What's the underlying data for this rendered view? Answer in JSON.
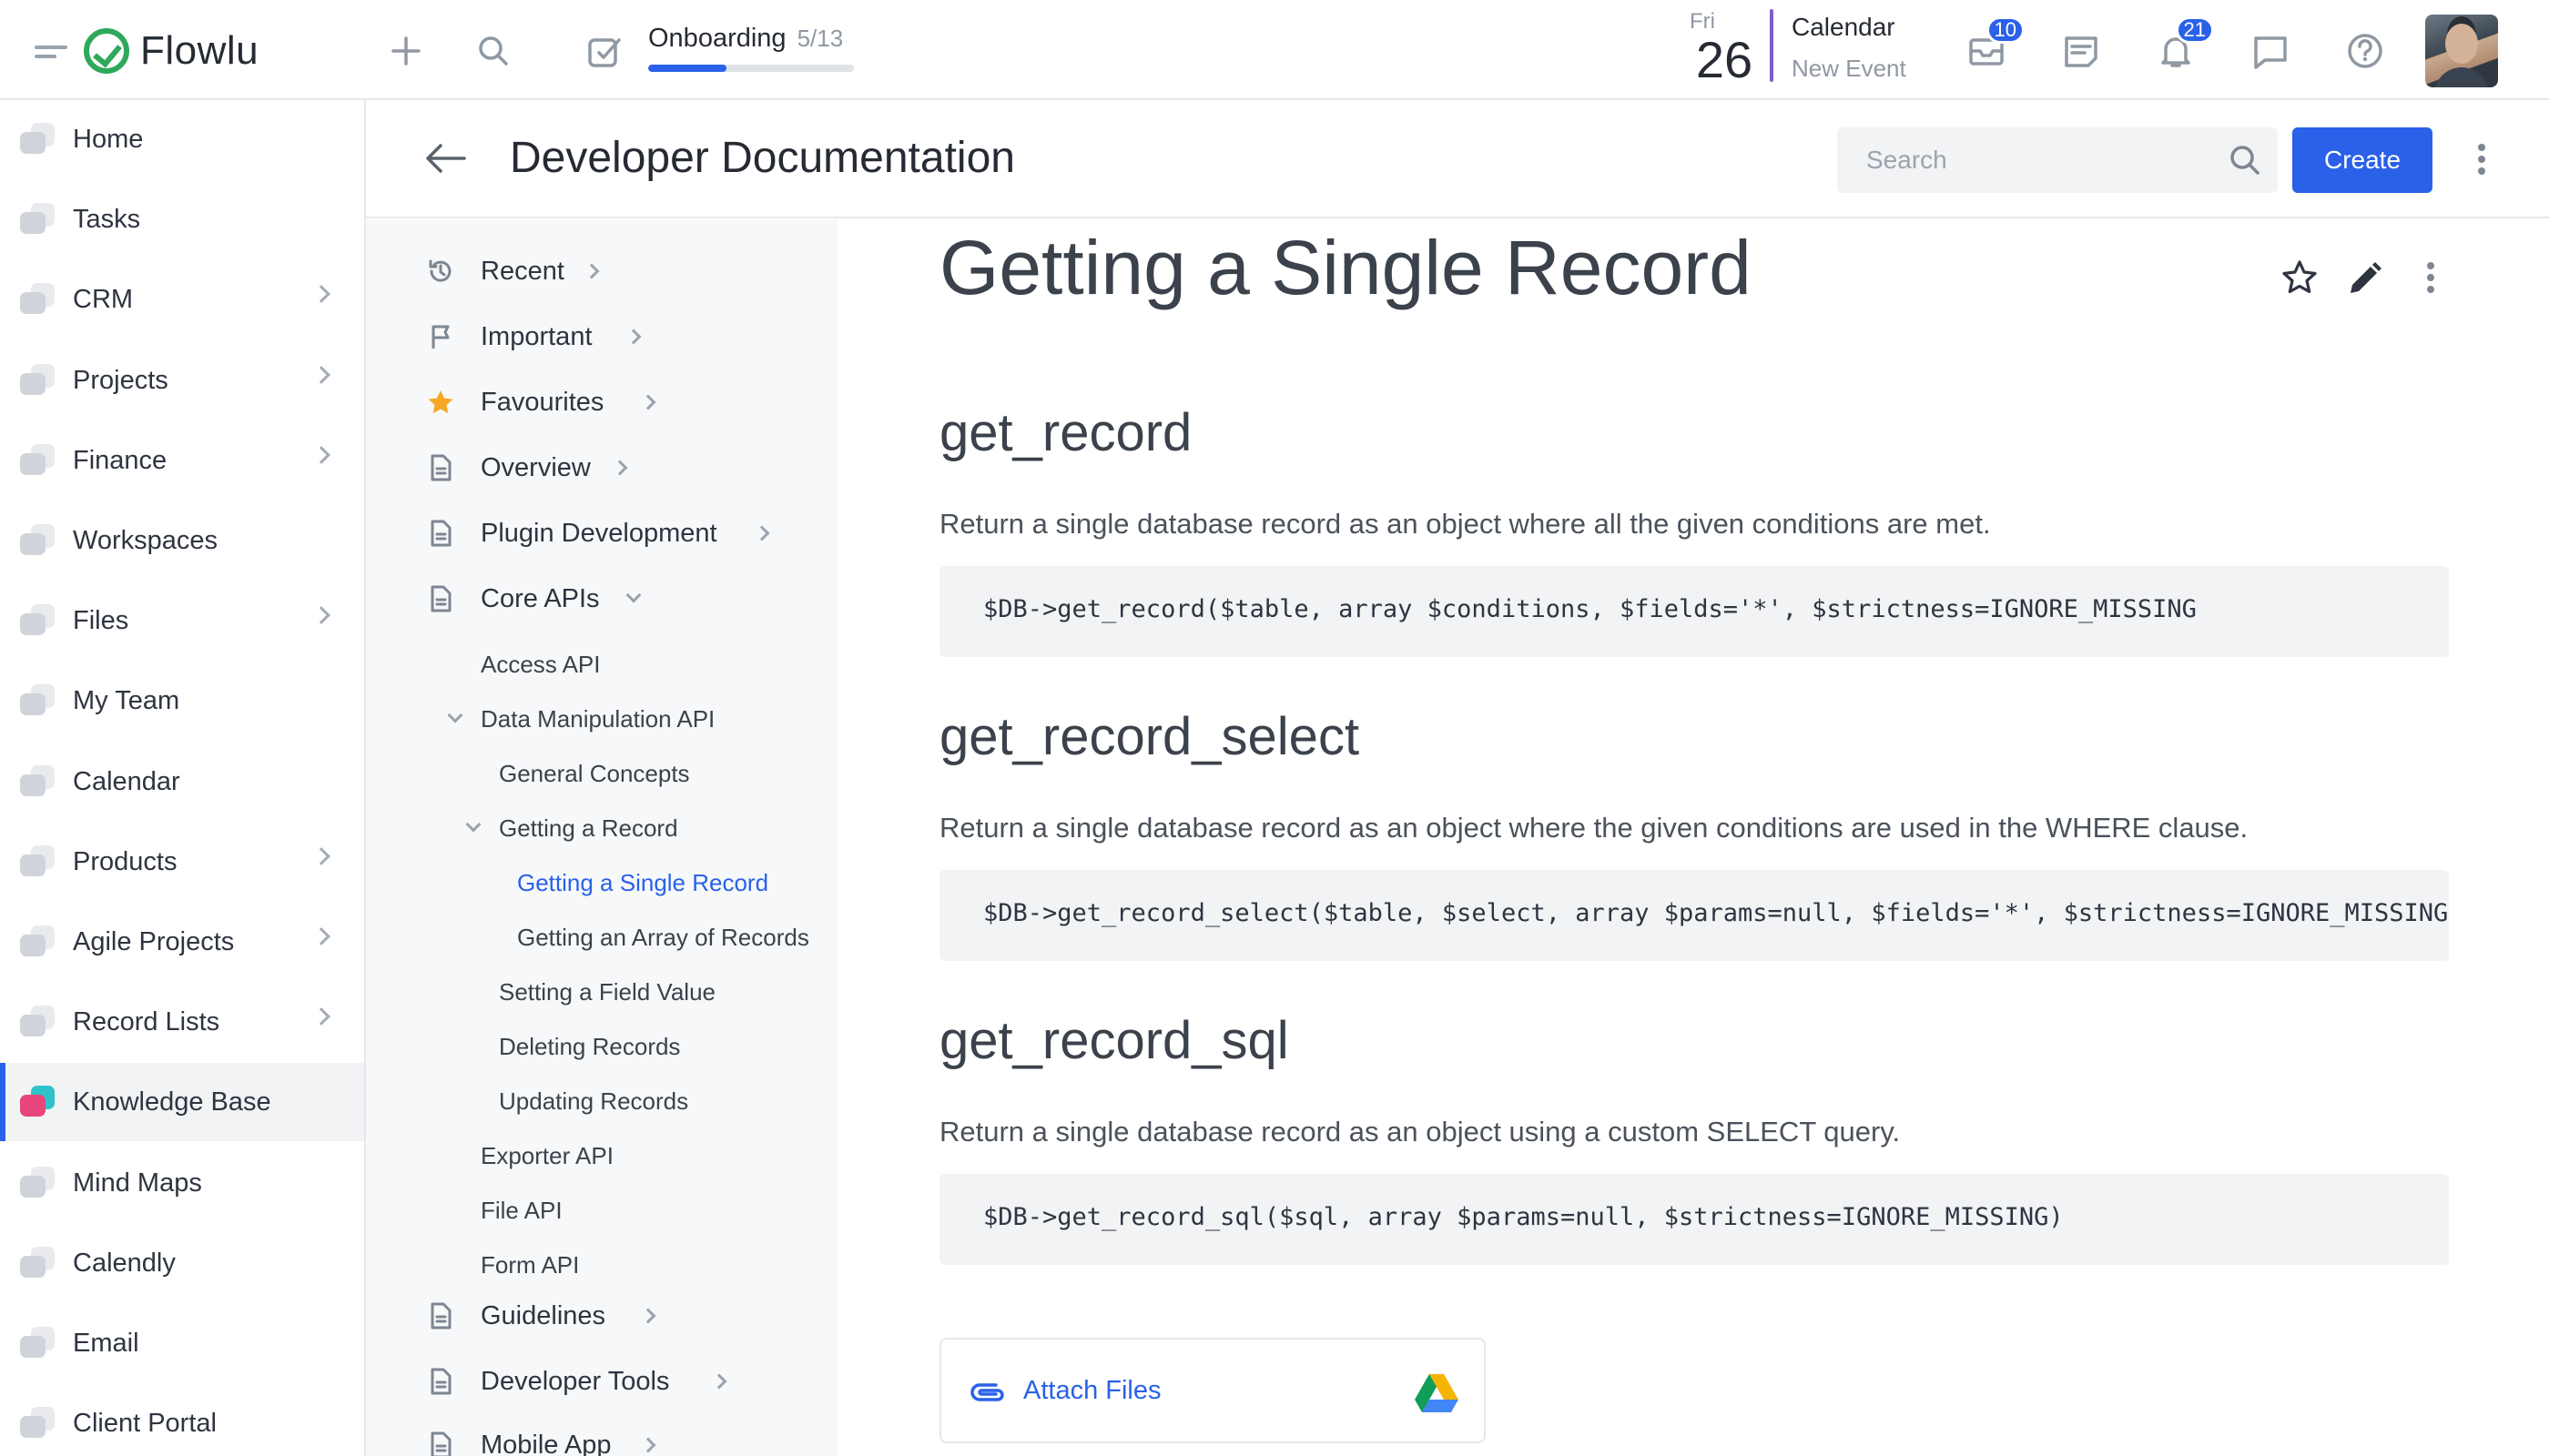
{
  "topbar": {
    "logo_text": "Flowlu",
    "onboarding": {
      "title": "Onboarding",
      "count": "5/13",
      "progress": 0.38
    },
    "date": {
      "weekday": "Fri",
      "day": "26"
    },
    "calendar": {
      "title": "Calendar",
      "subtitle": "New Event"
    },
    "badges": {
      "mail": "10",
      "notifications": "21"
    },
    "icons": [
      "menu-icon",
      "plus-icon",
      "search-icon",
      "onboarding-icon",
      "mail-icon",
      "notes-icon",
      "bell-icon",
      "chat-icon",
      "help-icon"
    ]
  },
  "sidebar": {
    "items": [
      {
        "label": "Home",
        "chevron": false
      },
      {
        "label": "Tasks",
        "chevron": false
      },
      {
        "label": "CRM",
        "chevron": true
      },
      {
        "label": "Projects",
        "chevron": true
      },
      {
        "label": "Finance",
        "chevron": true
      },
      {
        "label": "Workspaces",
        "chevron": false
      },
      {
        "label": "Files",
        "chevron": true
      },
      {
        "label": "My Team",
        "chevron": false
      },
      {
        "label": "Calendar",
        "chevron": false
      },
      {
        "label": "Products",
        "chevron": true
      },
      {
        "label": "Agile Projects",
        "chevron": true
      },
      {
        "label": "Record Lists",
        "chevron": true
      },
      {
        "label": "Knowledge Base",
        "chevron": false,
        "active": true
      },
      {
        "label": "Mind Maps",
        "chevron": false
      },
      {
        "label": "Calendly",
        "chevron": false
      },
      {
        "label": "Email",
        "chevron": false
      },
      {
        "label": "Client Portal",
        "chevron": false
      }
    ]
  },
  "header": {
    "title": "Developer Documentation",
    "search_placeholder": "Search",
    "create_label": "Create"
  },
  "tree": {
    "items": [
      {
        "label": "Recent",
        "icon": "history-icon",
        "level": 0
      },
      {
        "label": "Important",
        "icon": "flag-icon",
        "level": 0
      },
      {
        "label": "Favourites",
        "icon": "star-icon",
        "level": 0
      },
      {
        "label": "Overview",
        "icon": "document-icon",
        "level": 0
      },
      {
        "label": "Plugin Development",
        "icon": "document-icon",
        "level": 0
      },
      {
        "label": "Core APIs",
        "icon": "document-icon",
        "level": 0,
        "expanded": true
      },
      {
        "label": "Access API",
        "level": 1
      },
      {
        "label": "Data Manipulation API",
        "level": 1,
        "expanded": true
      },
      {
        "label": "General Concepts",
        "level": 2
      },
      {
        "label": "Getting a Record",
        "level": 2,
        "expanded": true
      },
      {
        "label": "Getting a Single Record",
        "level": 3,
        "active": true
      },
      {
        "label": "Getting an Array of Records",
        "level": 3
      },
      {
        "label": "Setting a Field Value",
        "level": 2
      },
      {
        "label": "Deleting Records",
        "level": 2
      },
      {
        "label": "Updating Records",
        "level": 2
      },
      {
        "label": "Exporter API",
        "level": 1
      },
      {
        "label": "File API",
        "level": 1
      },
      {
        "label": "Form API",
        "level": 1
      },
      {
        "label": "Guidelines",
        "icon": "document-icon",
        "level": 0
      },
      {
        "label": "Developer Tools",
        "icon": "document-icon",
        "level": 0
      },
      {
        "label": "Mobile App",
        "icon": "document-icon",
        "level": 0
      }
    ]
  },
  "article": {
    "title": "Getting a Single Record",
    "sections": [
      {
        "heading": "get_record",
        "description": "Return a single database record as an object where all the given conditions are met.",
        "code": "$DB->get_record($table, array $conditions, $fields='*', $strictness=IGNORE_MISSING"
      },
      {
        "heading": "get_record_select",
        "description": "Return a single database record as an object where the given conditions are used in the WHERE clause.",
        "code": "$DB->get_record_select($table, $select, array $params=null, $fields='*', $strictness=IGNORE_MISSING"
      },
      {
        "heading": "get_record_sql",
        "description": "Return a single database record as an object using a custom SELECT query.",
        "code": "$DB->get_record_sql($sql, array $params=null, $strictness=IGNORE_MISSING)"
      }
    ],
    "attach_label": "Attach Files"
  },
  "colors": {
    "accent": "#2a61e8",
    "brand_green": "#2ea95b",
    "favourite_star": "#f5a623"
  }
}
